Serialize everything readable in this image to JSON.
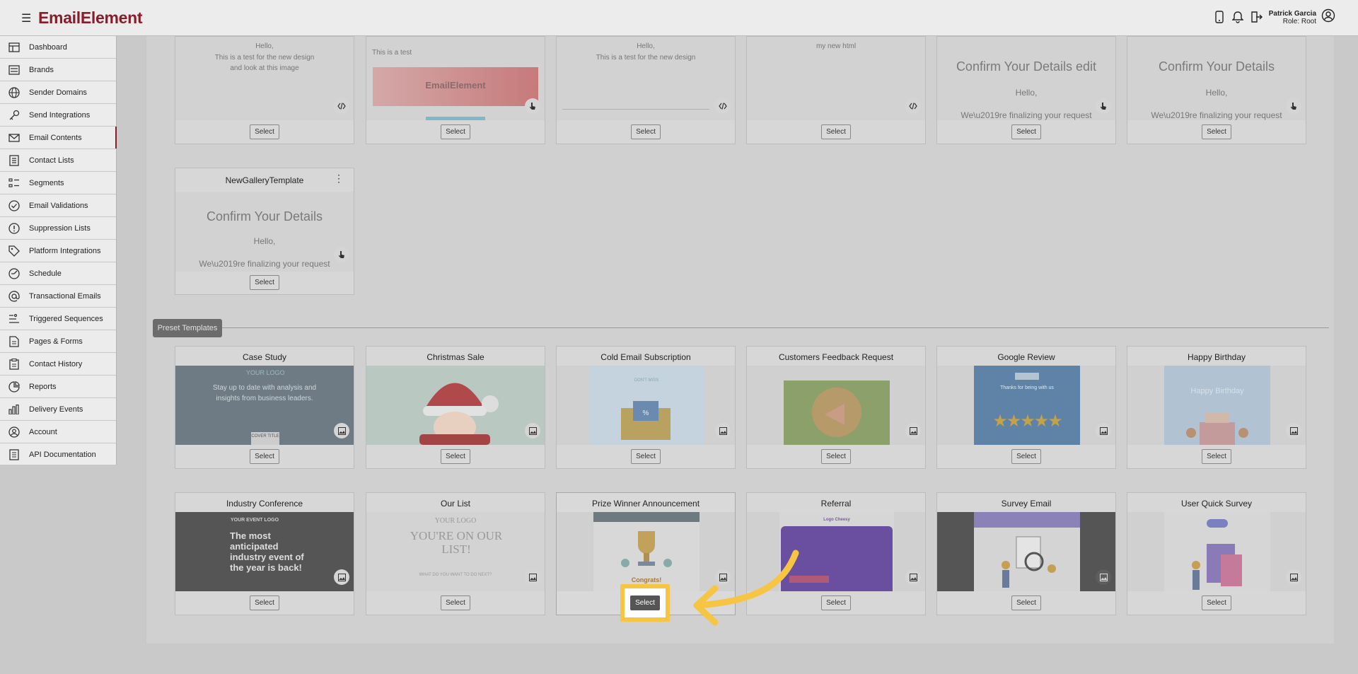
{
  "header": {
    "logo": "EmailElement",
    "user_name": "Patrick Garcia",
    "user_role": "Role: Root"
  },
  "sidebar": {
    "items": [
      {
        "label": "Dashboard",
        "icon": "dashboard-icon"
      },
      {
        "label": "Brands",
        "icon": "brands-icon"
      },
      {
        "label": "Sender Domains",
        "icon": "globe-icon"
      },
      {
        "label": "Send Integrations",
        "icon": "key-icon"
      },
      {
        "label": "Email Contents",
        "icon": "envelope-icon"
      },
      {
        "label": "Contact Lists",
        "icon": "contact-list-icon"
      },
      {
        "label": "Segments",
        "icon": "segments-icon"
      },
      {
        "label": "Email Validations",
        "icon": "check-circle-icon"
      },
      {
        "label": "Suppression Lists",
        "icon": "alert-circle-icon"
      },
      {
        "label": "Platform Integrations",
        "icon": "tag-icon"
      },
      {
        "label": "Schedule",
        "icon": "schedule-icon"
      },
      {
        "label": "Transactional Emails",
        "icon": "at-icon"
      },
      {
        "label": "Triggered Sequences",
        "icon": "triggered-icon"
      },
      {
        "label": "Pages & Forms",
        "icon": "page-icon"
      },
      {
        "label": "Contact History",
        "icon": "clipboard-icon"
      },
      {
        "label": "Reports",
        "icon": "pie-chart-icon"
      },
      {
        "label": "Delivery Events",
        "icon": "bar-chart-icon"
      },
      {
        "label": "Account",
        "icon": "account-icon"
      },
      {
        "label": "API Documentation",
        "icon": "doc-icon"
      }
    ]
  },
  "custom_templates": {
    "row1": [
      {
        "text1": "Hello,",
        "text2": "This is a test for the new design",
        "text3": "and look at this image",
        "badge": "code-icon"
      },
      {
        "text1": "This is a test",
        "logo": "EmailElement",
        "badge": "pointer-icon"
      },
      {
        "text1": "Hello,",
        "text2": "This is a test for the new design",
        "badge": "code-icon"
      },
      {
        "text1": "my new html",
        "badge": "code-icon"
      },
      {
        "heading": "Confirm Your Details edit",
        "hello": "Hello,",
        "sub": "We\\u2019re finalizing your request",
        "badge": "pointer-icon"
      },
      {
        "heading": "Confirm Your Details",
        "hello": "Hello,",
        "sub": "We\\u2019re finalizing your request",
        "badge": "pointer-icon"
      }
    ],
    "gallery": {
      "title": "NewGalleryTemplate",
      "heading": "Confirm Your Details",
      "hello": "Hello,",
      "sub": "We\\u2019re finalizing your request"
    }
  },
  "select_label": "Select",
  "preset_label": "Preset Templates",
  "presets_row1": [
    {
      "title": "Case Study",
      "line1": "Stay up to date with analysis and",
      "line2": "insights from business leaders.",
      "btn": "COVER\nTITLE",
      "logo": "YOUR LOGO"
    },
    {
      "title": "Christmas Sale"
    },
    {
      "title": "Cold Email Subscription",
      "l1": "DON'T MISS"
    },
    {
      "title": "Customers Feedback Request"
    },
    {
      "title": "Google Review",
      "l1": "Thanks for being with us"
    },
    {
      "title": "Happy Birthday",
      "l1": "Happy Birthday"
    }
  ],
  "presets_row2": [
    {
      "title": "Industry Conference",
      "logo": "YOUR EVENT LOGO",
      "text": "The most anticipated industry event of the year is back!"
    },
    {
      "title": "Our List",
      "logo": "YOUR LOGO",
      "text": "YOU'RE ON OUR LIST!",
      "sub": "WHAT DO YOU WANT TO DO NEXT?"
    },
    {
      "title": "Prize Winner Announcement",
      "congrats": "Congrats!"
    },
    {
      "title": "Referral",
      "logo": "Logo Cheesy"
    },
    {
      "title": "Survey Email"
    },
    {
      "title": "User Quick Survey"
    }
  ]
}
